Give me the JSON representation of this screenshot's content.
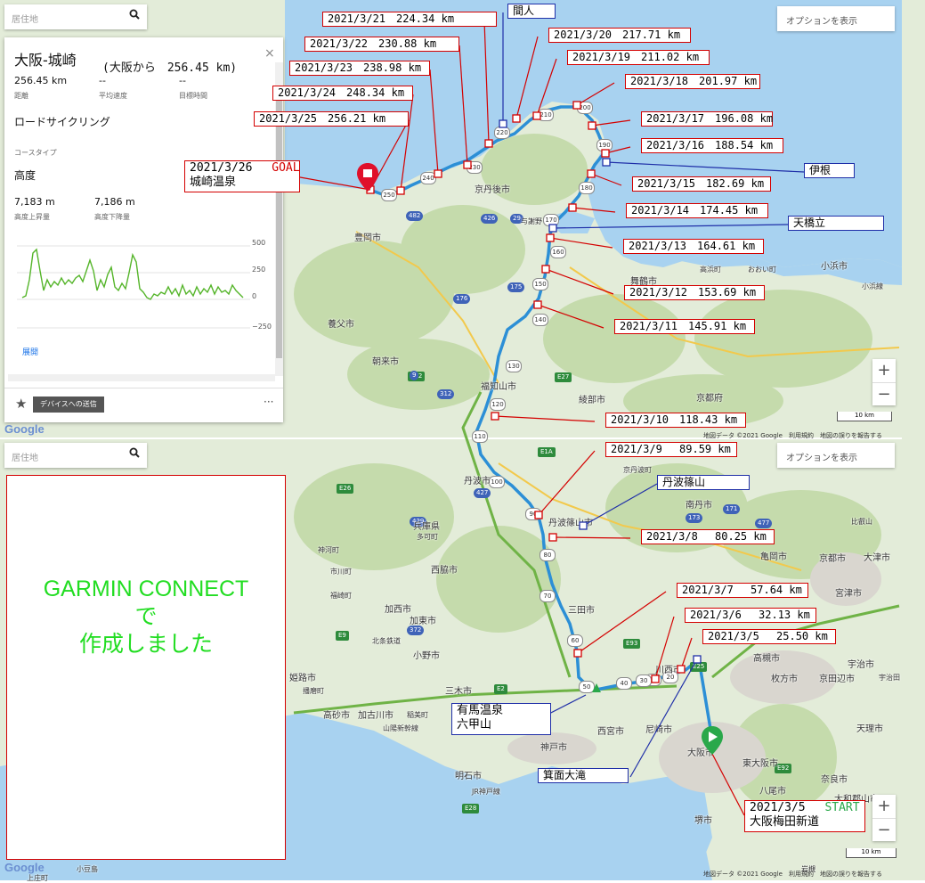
{
  "colors": {
    "water": "#a8d2f0",
    "land": "#e4eedb",
    "forest": "#c9ddb2",
    "road_red": "#d40000",
    "route": "#2c8fd6",
    "anno_blue": "#1f2fa8",
    "garmin_green": "#22dd22"
  },
  "top_map": {
    "search_placeholder": "居住地",
    "options_label": "オプションを表示",
    "info_panel": {
      "title": "大阪-城崎",
      "title_note": "(大阪から　256.45 km)",
      "stats": [
        {
          "value": "256.45 km",
          "label": "距離"
        },
        {
          "value": "--",
          "label": "平均速度"
        },
        {
          "value": "--",
          "label": "目標時間"
        }
      ],
      "course_type": "ロードサイクリング",
      "course_type_label": "コースタイプ",
      "elevation_heading": "高度",
      "elev_stats": [
        {
          "value": "7,183 m",
          "label": "高度上昇量"
        },
        {
          "value": "7,186 m",
          "label": "高度下降量"
        }
      ],
      "elev_axis": [
        "500",
        "250",
        "0",
        "−250"
      ],
      "expand_link": "展開",
      "send_button": "デバイスへの送信",
      "more": "···",
      "close": "×"
    },
    "scale": "10 km",
    "footer": "地図データ ©2021 Google　利用規約　地図の誤りを報告する"
  },
  "bottom_map": {
    "search_placeholder": "居住地",
    "options_label": "オプションを表示",
    "garmin_text": [
      "GARMIN CONNECT",
      "で",
      "作成しました"
    ],
    "scale": "10 km",
    "footer": "地図データ ©2021 Google　利用規約　地図の誤りを報告する"
  },
  "google": "Google",
  "map_labels": [
    "京丹後市",
    "与謝野",
    "舞鶴市",
    "高浜町",
    "おおい町",
    "小浜市",
    "小浜線",
    "豊岡市",
    "養父市",
    "朝来市",
    "福知山市",
    "綾部市",
    "京都府",
    "丹波市",
    "京丹波町",
    "南丹市",
    "丹波篠山市",
    "兵庫県",
    "多可町",
    "西脇市",
    "加西市",
    "加東市",
    "小野市",
    "三田市",
    "三木市",
    "神戸市",
    "明石市",
    "姫路市",
    "高砂市",
    "加古川市",
    "稲美町",
    "西宮市",
    "尼崎市",
    "川西市",
    "高槻市",
    "枚方市",
    "京田辺市",
    "宇治市",
    "大阪市",
    "東大阪市",
    "八尾市",
    "堺市",
    "奈良市",
    "大和郡山市",
    "天理市",
    "宮津市",
    "亀岡市",
    "京都市",
    "大津市",
    "比叡山",
    "神河町",
    "市川町",
    "福崎町",
    "北条鉄道",
    "山陽新幹線",
    "JR神戸線",
    "播磨町",
    "岩槻",
    "小豆島",
    "上庄町",
    "宇治田"
  ],
  "annotations": [
    {
      "text": "2021/3/21　224.34 km",
      "color": "red"
    },
    {
      "text": "間人",
      "color": "blue"
    },
    {
      "text": "2021/3/22　230.88 km",
      "color": "red"
    },
    {
      "text": "2021/3/20　217.71 km",
      "color": "red"
    },
    {
      "text": "2021/3/23　238.98 km",
      "color": "red"
    },
    {
      "text": "2021/3/19　211.02 km",
      "color": "red"
    },
    {
      "text": "2021/3/18　201.97 km",
      "color": "red"
    },
    {
      "text": "2021/3/24　248.34 km",
      "color": "red"
    },
    {
      "text": "2021/3/25　256.21 km",
      "color": "red"
    },
    {
      "text": "2021/3/17　196.08 km",
      "color": "red"
    },
    {
      "text": "2021/3/16　188.54 km",
      "color": "red"
    },
    {
      "text": "伊根",
      "color": "blue"
    },
    {
      "text": "2021/3/15　182.69 km",
      "color": "red"
    },
    {
      "text": "2021/3/14　174.45 km",
      "color": "red"
    },
    {
      "text": "天橋立",
      "color": "blue"
    },
    {
      "text": "2021/3/13　164.61 km",
      "color": "red"
    },
    {
      "text": "2021/3/12　153.69 km",
      "color": "red"
    },
    {
      "text": "2021/3/11　145.91 km",
      "color": "red"
    },
    {
      "text": "2021/3/10　118.43 km",
      "color": "red"
    },
    {
      "text": "2021/3/9　 89.59 km",
      "color": "red"
    },
    {
      "text": "丹波篠山",
      "color": "blue"
    },
    {
      "text": "2021/3/8　 80.25 km",
      "color": "red"
    },
    {
      "text": "2021/3/7　 57.64 km",
      "color": "red"
    },
    {
      "text": "2021/3/6　 32.13 km",
      "color": "red"
    },
    {
      "text": "2021/3/5　 25.50 km",
      "color": "red"
    },
    {
      "text": "箕面大滝",
      "color": "blue"
    }
  ],
  "goal_box": {
    "date": "2021/3/26",
    "status": "GOAL",
    "place": "城崎温泉"
  },
  "start_box": {
    "date": "2021/3/5",
    "status": "START",
    "place": "大阪梅田新道"
  },
  "arima_box": {
    "line1": "有馬温泉",
    "line2": "六甲山"
  },
  "km_markers": [
    "10",
    "20",
    "30",
    "40",
    "50",
    "60",
    "70",
    "80",
    "90",
    "100",
    "110",
    "120",
    "130",
    "140",
    "150",
    "160",
    "170",
    "180",
    "190",
    "200",
    "210",
    "220",
    "230",
    "240",
    "250"
  ],
  "road_badges": [
    "E2",
    "E27",
    "E9",
    "E72",
    "312",
    "482",
    "426",
    "176",
    "175",
    "427",
    "429",
    "372",
    "E25",
    "E93",
    "E26",
    "173",
    "171",
    "477",
    "E28",
    "9",
    "29",
    "E1A",
    "E92"
  ]
}
